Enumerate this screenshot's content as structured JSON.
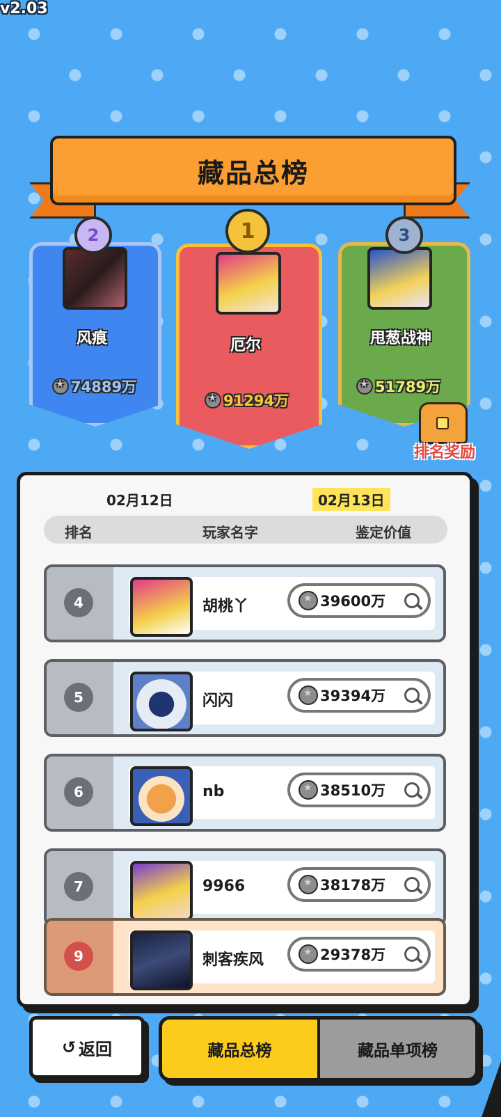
{
  "version": "v2.03",
  "title": "藏品总榜",
  "podium": [
    {
      "place": "2",
      "name": "风痕",
      "score": "74889万",
      "score_color": "#9cc4f7"
    },
    {
      "place": "1",
      "name": "厄尔",
      "score": "91294万",
      "score_color": "#f8c53a"
    },
    {
      "place": "3",
      "name": "甩葱战神",
      "score": "51789万",
      "score_color": "#e9f06b"
    }
  ],
  "reward_label": "排名奖励",
  "dates": [
    "02月12日",
    "02月13日"
  ],
  "columns": {
    "rank": "排名",
    "name": "玩家名字",
    "value": "鉴定价值"
  },
  "rows": [
    {
      "rank": "4",
      "name": "胡桃丫",
      "value": "39600万"
    },
    {
      "rank": "5",
      "name": "闪闪",
      "value": "39394万"
    },
    {
      "rank": "6",
      "name": "nb",
      "value": "38510万"
    },
    {
      "rank": "7",
      "name": "9966",
      "value": "38178万"
    }
  ],
  "my_row": {
    "rank": "9",
    "name": "刺客疾风",
    "value": "29378万"
  },
  "back_label": "返回",
  "back_icon": "↺",
  "tabs": [
    "藏品总榜",
    "藏品单项榜"
  ],
  "icons": [
    "coin-icon",
    "search-icon",
    "treasure-chest-icon",
    "medal-icon",
    "back-arrow-icon"
  ]
}
